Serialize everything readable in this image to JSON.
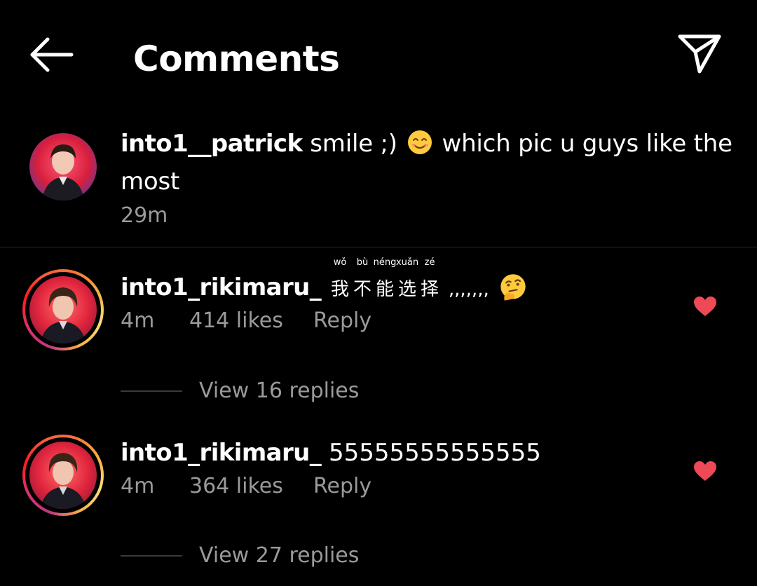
{
  "header": {
    "title": "Comments",
    "back_icon": "arrow-left-icon",
    "share_icon": "paper-plane-icon"
  },
  "caption": {
    "username": "into1__patrick",
    "text_before_emoji": "smile ;)",
    "emoji": "smiling-face-emoji",
    "text_line1_after": "which pic u guys like the",
    "text_line2": "most",
    "time": "29m"
  },
  "comments": [
    {
      "username": "into1_rikimaru_",
      "pinyin_words": [
        {
          "pinyin": "wǒ",
          "hanzi": "我"
        },
        {
          "pinyin": "bù",
          "hanzi": "不"
        },
        {
          "pinyin": "néng",
          "hanzi": "能"
        },
        {
          "pinyin": "xuǎn",
          "hanzi": "选"
        },
        {
          "pinyin": "zé",
          "hanzi": "择"
        }
      ],
      "text_after": ",,,,,,,",
      "emoji": "thinking-face-emoji",
      "time": "4m",
      "likes": "414 likes",
      "reply": "Reply",
      "view_replies": "View 16 replies",
      "liked": true
    },
    {
      "username": "into1_rikimaru_",
      "text": "55555555555555",
      "time": "4m",
      "likes": "364 likes",
      "reply": "Reply",
      "view_replies": "View 27 replies",
      "liked": true
    }
  ],
  "colors": {
    "background": "#000000",
    "text": "#ffffff",
    "secondary_text": "#9a9a9a",
    "heart": "#ed4956",
    "divider": "#262626"
  }
}
